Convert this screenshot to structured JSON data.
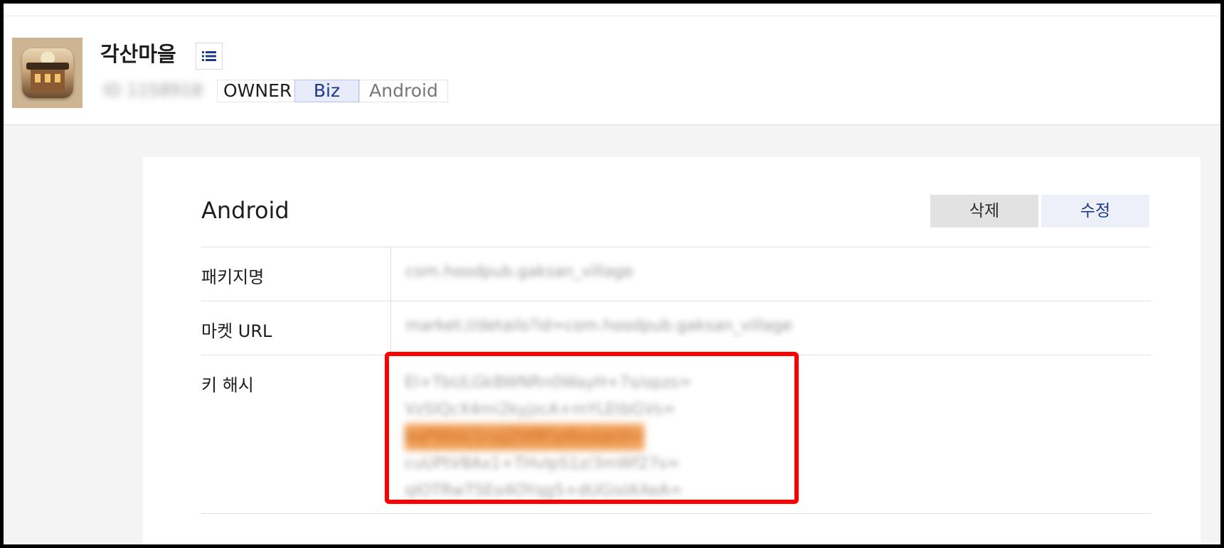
{
  "app": {
    "title": "각산마을",
    "id_text": "ID 1158918",
    "tags": {
      "owner": "OWNER",
      "biz": "Biz",
      "platform": "Android"
    }
  },
  "section": {
    "title": "Android",
    "delete_label": "삭제",
    "edit_label": "수정"
  },
  "fields": {
    "package_label": "패키지명",
    "package_value": "com.hoodpub.gaksan_village",
    "market_label": "마켓 URL",
    "market_value": "market://details?id=com.hoodpub.gaksan_village",
    "keyhash_label": "키 해시",
    "keyhash_lines": [
      "EI+TbULGkBWNRn0WayH+7s/opzs=",
      "VzSIQcX4mi2kyjzcA+mYLEtbGVs=",
      "bqPWbk/1ryjjZWBFpl6edqk0I=",
      "cuUPtV8Ax1+THvIpS1z/3mWf27s=",
      "qIOTRwTSEo4OYqg5+dUGisIAXeA="
    ]
  },
  "colors": {
    "accent": "#1d3a8a",
    "highlight": "#f2a25c",
    "annotation": "#ff0000"
  },
  "icons": {
    "list": "list-icon",
    "app": "app-icon"
  }
}
